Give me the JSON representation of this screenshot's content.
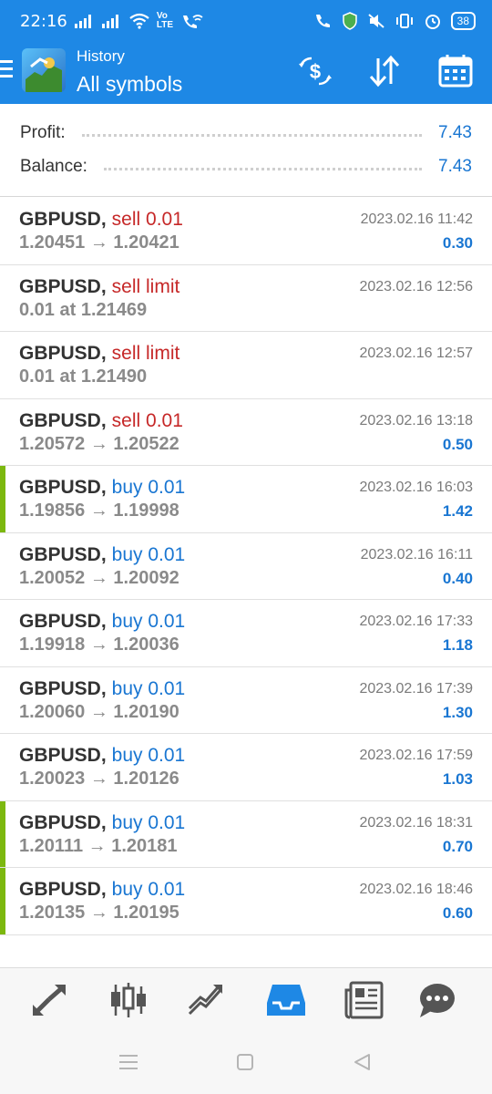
{
  "status": {
    "time": "22:16",
    "volte_top": "Vo",
    "volte_bottom": "LTE",
    "battery": "38"
  },
  "header": {
    "title": "History",
    "subtitle": "All symbols"
  },
  "summary": {
    "profit_label": "Profit:",
    "profit_value": "7.43",
    "balance_label": "Balance:",
    "balance_value": "7.43"
  },
  "deals": [
    {
      "symbol": "GBPUSD,",
      "type": "sell 0.01",
      "kind": "sell",
      "prices": "1.20451 → 1.20421",
      "date": "2023.02.16 11:42",
      "profit": "0.30"
    },
    {
      "symbol": "GBPUSD,",
      "type": "sell limit",
      "kind": "sell",
      "prices": "0.01 at 1.21469",
      "date": "2023.02.16 12:56",
      "profit": ""
    },
    {
      "symbol": "GBPUSD,",
      "type": "sell limit",
      "kind": "sell",
      "prices": "0.01 at 1.21490",
      "date": "2023.02.16 12:57",
      "profit": ""
    },
    {
      "symbol": "GBPUSD,",
      "type": "sell 0.01",
      "kind": "sell",
      "prices": "1.20572 → 1.20522",
      "date": "2023.02.16 13:18",
      "profit": "0.50"
    },
    {
      "symbol": "GBPUSD,",
      "type": "buy 0.01",
      "kind": "buy",
      "prices": "1.19856 → 1.19998",
      "date": "2023.02.16 16:03",
      "profit": "1.42"
    },
    {
      "symbol": "GBPUSD,",
      "type": "buy 0.01",
      "kind": "buy",
      "prices": "1.20052 → 1.20092",
      "date": "2023.02.16 16:11",
      "profit": "0.40"
    },
    {
      "symbol": "GBPUSD,",
      "type": "buy 0.01",
      "kind": "buy",
      "prices": "1.19918 → 1.20036",
      "date": "2023.02.16 17:33",
      "profit": "1.18"
    },
    {
      "symbol": "GBPUSD,",
      "type": "buy 0.01",
      "kind": "buy",
      "prices": "1.20060 → 1.20190",
      "date": "2023.02.16 17:39",
      "profit": "1.30"
    },
    {
      "symbol": "GBPUSD,",
      "type": "buy 0.01",
      "kind": "buy",
      "prices": "1.20023 → 1.20126",
      "date": "2023.02.16 17:59",
      "profit": "1.03"
    },
    {
      "symbol": "GBPUSD,",
      "type": "buy 0.01",
      "kind": "buy",
      "prices": "1.20111 → 1.20181",
      "date": "2023.02.16 18:31",
      "profit": "0.70"
    },
    {
      "symbol": "GBPUSD,",
      "type": "buy 0.01",
      "kind": "buy",
      "prices": "1.20135 → 1.20195",
      "date": "2023.02.16 18:46",
      "profit": "0.60"
    }
  ],
  "row_markers": [
    false,
    false,
    false,
    false,
    true,
    false,
    false,
    false,
    false,
    true,
    true
  ],
  "colors": {
    "brand": "#1e88e5",
    "sell": "#c62828",
    "buy": "#1976d2",
    "marker": "#7cb80f"
  },
  "bottom_nav": [
    "trade-icon",
    "quotes-chart-icon",
    "chart-icon",
    "history-icon",
    "news-icon",
    "messages-icon"
  ],
  "bottom_nav_active": "history-icon"
}
